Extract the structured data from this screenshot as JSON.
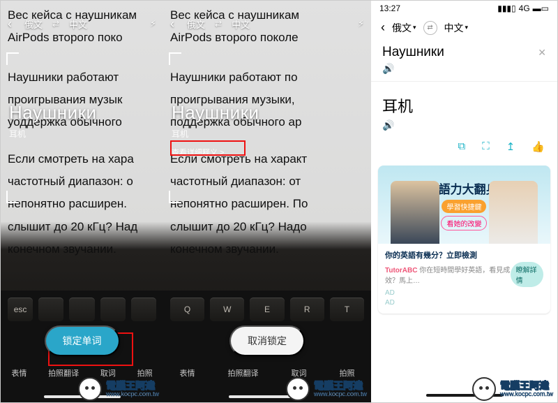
{
  "panel1": {
    "topbar": {
      "src": "俄文",
      "dst": "中文"
    },
    "article": {
      "l1": "Вес кейса с наушникам",
      "l2": "AirPods второго поко",
      "l3": "Наушники работают",
      "l4": "проигрывания музык",
      "l5": "уоддержка обычного",
      "l6": "Если смотреть на хара",
      "l7": "частотный диапазон: о",
      "l8": "непонятно расширен.",
      "l9": "слышит до 20 кГц? Над",
      "l10": "конечном звучании."
    },
    "overlay": {
      "word": "Наушники",
      "translation": "耳机"
    },
    "button": "锁定单词",
    "tabs": {
      "t1": "表情",
      "t2": "拍照翻译",
      "t3": "取词",
      "t4": "拍照"
    },
    "keys": [
      "esc",
      "",
      "",
      "",
      "",
      ""
    ]
  },
  "panel2": {
    "topbar": {
      "src": "俄文",
      "dst": "中文"
    },
    "article": {
      "l1": "Вес кейса с наушникам",
      "l2": "AirPods второго поколе",
      "l3": "Наушники работают по",
      "l4": "проигрывания музыки,",
      "l5": "поддержка обычного ар",
      "l6": "Если смотреть на характ",
      "l7": "частотный диапазон: от",
      "l8": "непонятно расширен. По",
      "l9": "слышит до 20 кГц? Надо",
      "l10": "конечном звучании."
    },
    "overlay": {
      "word": "Наушники",
      "translation": "耳机",
      "detail": "查看详细释义 >"
    },
    "button": "取消锁定",
    "tabs": {
      "t1": "表情",
      "t2": "拍照翻译",
      "t3": "取词",
      "t4": "拍照"
    },
    "keys": [
      "Q",
      "W",
      "E",
      "R",
      "T"
    ]
  },
  "panel3": {
    "status": {
      "time": "13:27",
      "net": "4G"
    },
    "head": {
      "src": "俄文",
      "dst": "中文"
    },
    "source_word": "Наушники",
    "translation": "耳机",
    "ad": {
      "title": "英語力大翻身!",
      "badge1": "學習快捷鍵",
      "badge2": "看她的改變",
      "q": "你的英語有幾分？立即檢測",
      "sub": "你在短時間學好英語，看見成效？馬上…",
      "brand": "TutorABC",
      "label": "AD",
      "cta": "瞭解詳情"
    }
  },
  "watermark": {
    "name": "電腦王阿達",
    "url": "www.kocpc.com.tw"
  }
}
